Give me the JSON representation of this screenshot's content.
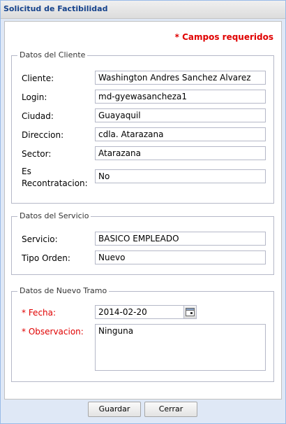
{
  "window": {
    "title": "Solicitud de Factibilidad"
  },
  "required_note": "* Campos requeridos",
  "cliente": {
    "legend": "Datos del Cliente",
    "fields": [
      {
        "label": "Cliente:",
        "value": "Washington Andres Sanchez Alvarez"
      },
      {
        "label": "Login:",
        "value": "md-gyewasancheza1"
      },
      {
        "label": "Ciudad:",
        "value": "Guayaquil"
      },
      {
        "label": "Direccion:",
        "value": "cdla. Atarazana"
      },
      {
        "label": "Sector:",
        "value": "Atarazana"
      },
      {
        "label_line1": "Es",
        "label_line2": "Recontratacion:",
        "value": "No"
      }
    ]
  },
  "servicio": {
    "legend": "Datos del Servicio",
    "fields": [
      {
        "label": "Servicio:",
        "value": "BASICO EMPLEADO"
      },
      {
        "label": "Tipo Orden:",
        "value": "Nuevo"
      }
    ]
  },
  "tramo": {
    "legend": "Datos de Nuevo Tramo",
    "fecha": {
      "label": "* Fecha:",
      "value": "2014-02-20"
    },
    "observacion": {
      "label": "* Observacion:",
      "value": "Ninguna"
    }
  },
  "buttons": {
    "save": "Guardar",
    "close": "Cerrar"
  },
  "colors": {
    "required": "#e00000",
    "title_text": "#15428b",
    "window_bg": "#dfe8f6"
  }
}
